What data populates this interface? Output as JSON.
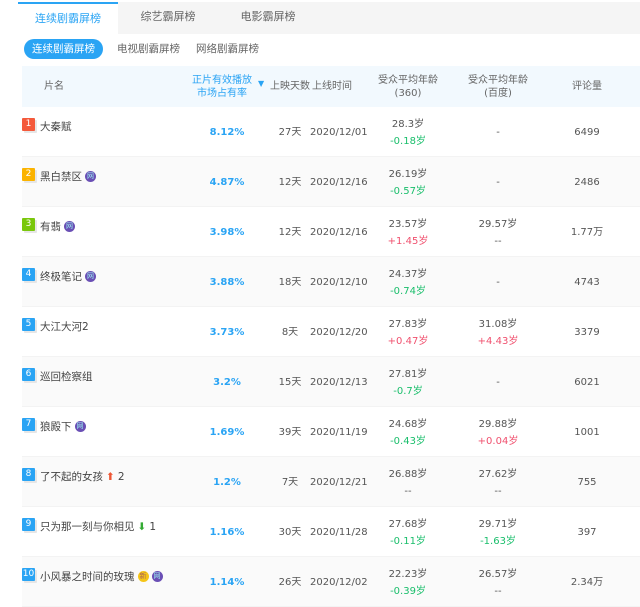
{
  "tabs": [
    "连续剧霸屏榜",
    "综艺霸屏榜",
    "电影霸屏榜"
  ],
  "subtabs": [
    "连续剧霸屏榜",
    "电视剧霸屏榜",
    "网络剧霸屏榜"
  ],
  "headers": {
    "name": "片名",
    "share1": "正片有效播放",
    "share2": "市场占有率",
    "days": "上映天数",
    "date": "上线时间",
    "age360_1": "受众平均年龄",
    "age360_2": "(360)",
    "agebd_1": "受众平均年龄",
    "agebd_2": "(百度)",
    "comments": "评论量"
  },
  "badge_colors": [
    "#f4593b",
    "#fbb300",
    "#7ac70c",
    "#2aa4f4"
  ],
  "rows": [
    {
      "rank": "1",
      "name": "大秦赋",
      "tags": [],
      "trend": "",
      "share": "8.12%",
      "days": "27天",
      "date": "2020/12/01",
      "age360": "28.3岁",
      "d360": "-0.18岁",
      "agebd": "-",
      "dbd": "",
      "comments": "6499"
    },
    {
      "rank": "2",
      "name": "黑白禁区",
      "tags": [
        "网"
      ],
      "trend": "",
      "share": "4.87%",
      "days": "12天",
      "date": "2020/12/16",
      "age360": "26.19岁",
      "d360": "-0.57岁",
      "agebd": "-",
      "dbd": "",
      "comments": "2486"
    },
    {
      "rank": "3",
      "name": "有翡",
      "tags": [
        "网"
      ],
      "trend": "",
      "share": "3.98%",
      "days": "12天",
      "date": "2020/12/16",
      "age360": "23.57岁",
      "d360": "+1.45岁",
      "agebd": "29.57岁",
      "dbd": "--",
      "comments": "1.77万"
    },
    {
      "rank": "4",
      "name": "终极笔记",
      "tags": [
        "网"
      ],
      "trend": "",
      "share": "3.88%",
      "days": "18天",
      "date": "2020/12/10",
      "age360": "24.37岁",
      "d360": "-0.74岁",
      "agebd": "-",
      "dbd": "",
      "comments": "4743"
    },
    {
      "rank": "5",
      "name": "大江大河2",
      "tags": [],
      "trend": "",
      "share": "3.73%",
      "days": "8天",
      "date": "2020/12/20",
      "age360": "27.83岁",
      "d360": "+0.47岁",
      "agebd": "31.08岁",
      "dbd": "+4.43岁",
      "comments": "3379"
    },
    {
      "rank": "6",
      "name": "巡回检察组",
      "tags": [],
      "trend": "",
      "share": "3.2%",
      "days": "15天",
      "date": "2020/12/13",
      "age360": "27.81岁",
      "d360": "-0.7岁",
      "agebd": "-",
      "dbd": "",
      "comments": "6021"
    },
    {
      "rank": "7",
      "name": "狼殿下",
      "tags": [
        "网"
      ],
      "trend": "",
      "share": "1.69%",
      "days": "39天",
      "date": "2020/11/19",
      "age360": "24.68岁",
      "d360": "-0.43岁",
      "agebd": "29.88岁",
      "dbd": "+0.04岁",
      "comments": "1001"
    },
    {
      "rank": "8",
      "name": "了不起的女孩",
      "tags": [],
      "trend": "up",
      "trendval": "2",
      "share": "1.2%",
      "days": "7天",
      "date": "2020/12/21",
      "age360": "26.88岁",
      "d360": "--",
      "agebd": "27.62岁",
      "dbd": "--",
      "comments": "755"
    },
    {
      "rank": "9",
      "name": "只为那一刻与你相见",
      "tags": [],
      "trend": "down",
      "trendval": "1",
      "share": "1.16%",
      "days": "30天",
      "date": "2020/11/28",
      "age360": "27.68岁",
      "d360": "-0.11岁",
      "agebd": "29.71岁",
      "dbd": "-1.63岁",
      "comments": "397"
    },
    {
      "rank": "10",
      "name": "小风暴之时间的玫瑰",
      "tags": [
        "新",
        "网"
      ],
      "trend": "",
      "share": "1.14%",
      "days": "26天",
      "date": "2020/12/02",
      "age360": "22.23岁",
      "d360": "-0.39岁",
      "agebd": "26.57岁",
      "dbd": "--",
      "comments": "2.34万"
    }
  ]
}
